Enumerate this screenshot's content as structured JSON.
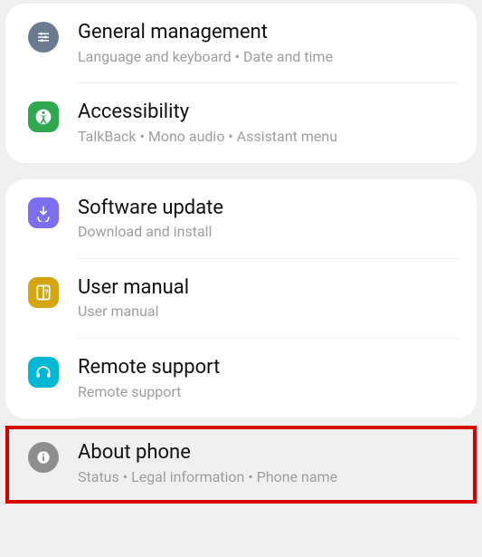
{
  "group1": {
    "general": {
      "title": "General management",
      "subtitle": "Language and keyboard  •  Date and time"
    },
    "accessibility": {
      "title": "Accessibility",
      "subtitle": "TalkBack  •  Mono audio  •  Assistant menu"
    }
  },
  "group2": {
    "software": {
      "title": "Software update",
      "subtitle": "Download and install"
    },
    "manual": {
      "title": "User manual",
      "subtitle": "User manual"
    },
    "remote": {
      "title": "Remote support",
      "subtitle": "Remote support"
    },
    "about": {
      "title": "About phone",
      "subtitle": "Status  •  Legal information  •  Phone name"
    }
  }
}
